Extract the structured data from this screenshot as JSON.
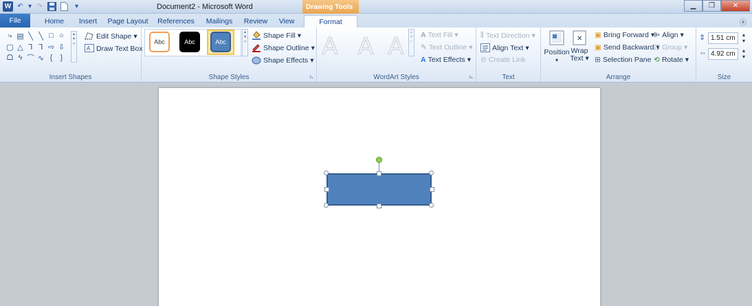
{
  "window": {
    "title": "Document2 - Microsoft Word",
    "context_tab_group": "Drawing Tools",
    "app_icon": "W"
  },
  "tabs": [
    "File",
    "Home",
    "Insert",
    "Page Layout",
    "References",
    "Mailings",
    "Review",
    "View",
    "Format"
  ],
  "active_tab": "Format",
  "ribbon": {
    "insert_shapes": {
      "label": "Insert Shapes",
      "edit_shape": "Edit Shape",
      "draw_text_box": "Draw Text Box"
    },
    "shape_styles": {
      "label": "Shape Styles",
      "thumbs": [
        "Abc",
        "Abc",
        "Abc"
      ],
      "shape_fill": "Shape Fill",
      "shape_outline": "Shape Outline",
      "shape_effects": "Shape Effects"
    },
    "wordart_styles": {
      "label": "WordArt Styles",
      "letters": [
        "A",
        "A",
        "A"
      ],
      "text_fill": "Text Fill",
      "text_outline": "Text Outline",
      "text_effects": "Text Effects"
    },
    "text": {
      "label": "Text",
      "text_direction": "Text Direction",
      "align_text": "Align Text",
      "create_link": "Create Link"
    },
    "arrange": {
      "label": "Arrange",
      "position": "Position",
      "wrap": "Wrap",
      "wrap_text": "Text",
      "bring_forward": "Bring Forward",
      "send_backward": "Send Backward",
      "selection_pane": "Selection Pane",
      "align": "Align",
      "group": "Group",
      "rotate": "Rotate"
    },
    "size": {
      "label": "Size",
      "height": "1.51 cm",
      "width": "4.92 cm"
    }
  },
  "colors": {
    "shape_fill": "#4f81bd",
    "shape_outline": "#385d8a",
    "context_tab": "#eaa553",
    "file_tab": "#2a65b0"
  }
}
